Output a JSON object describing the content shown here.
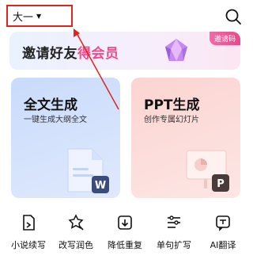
{
  "header": {
    "grade_select_label": "大一",
    "search_icon": "search-icon"
  },
  "banner": {
    "title_part1": "邀请好友",
    "title_part2": "得会员",
    "badge": "邀请码",
    "accent_color": "#f04b8c"
  },
  "cards": [
    {
      "title": "全文生成",
      "subtitle": "一键生成大纲全文",
      "icon": "word-document-icon",
      "accent": "#3b4b7e"
    },
    {
      "title": "PPT生成",
      "subtitle": "创作专属幻灯片",
      "icon": "ppt-presentation-icon",
      "accent": "#4a3b3b"
    }
  ],
  "tools": [
    {
      "label": "小说续写",
      "icon": "novel-continue-icon"
    },
    {
      "label": "改写润色",
      "icon": "polish-icon"
    },
    {
      "label": "降低重复",
      "icon": "reduce-duplicate-icon"
    },
    {
      "label": "单句扩写",
      "icon": "expand-sentence-icon"
    },
    {
      "label": "AI翻译",
      "icon": "translate-icon"
    }
  ],
  "annotation_color": "#e0241b"
}
